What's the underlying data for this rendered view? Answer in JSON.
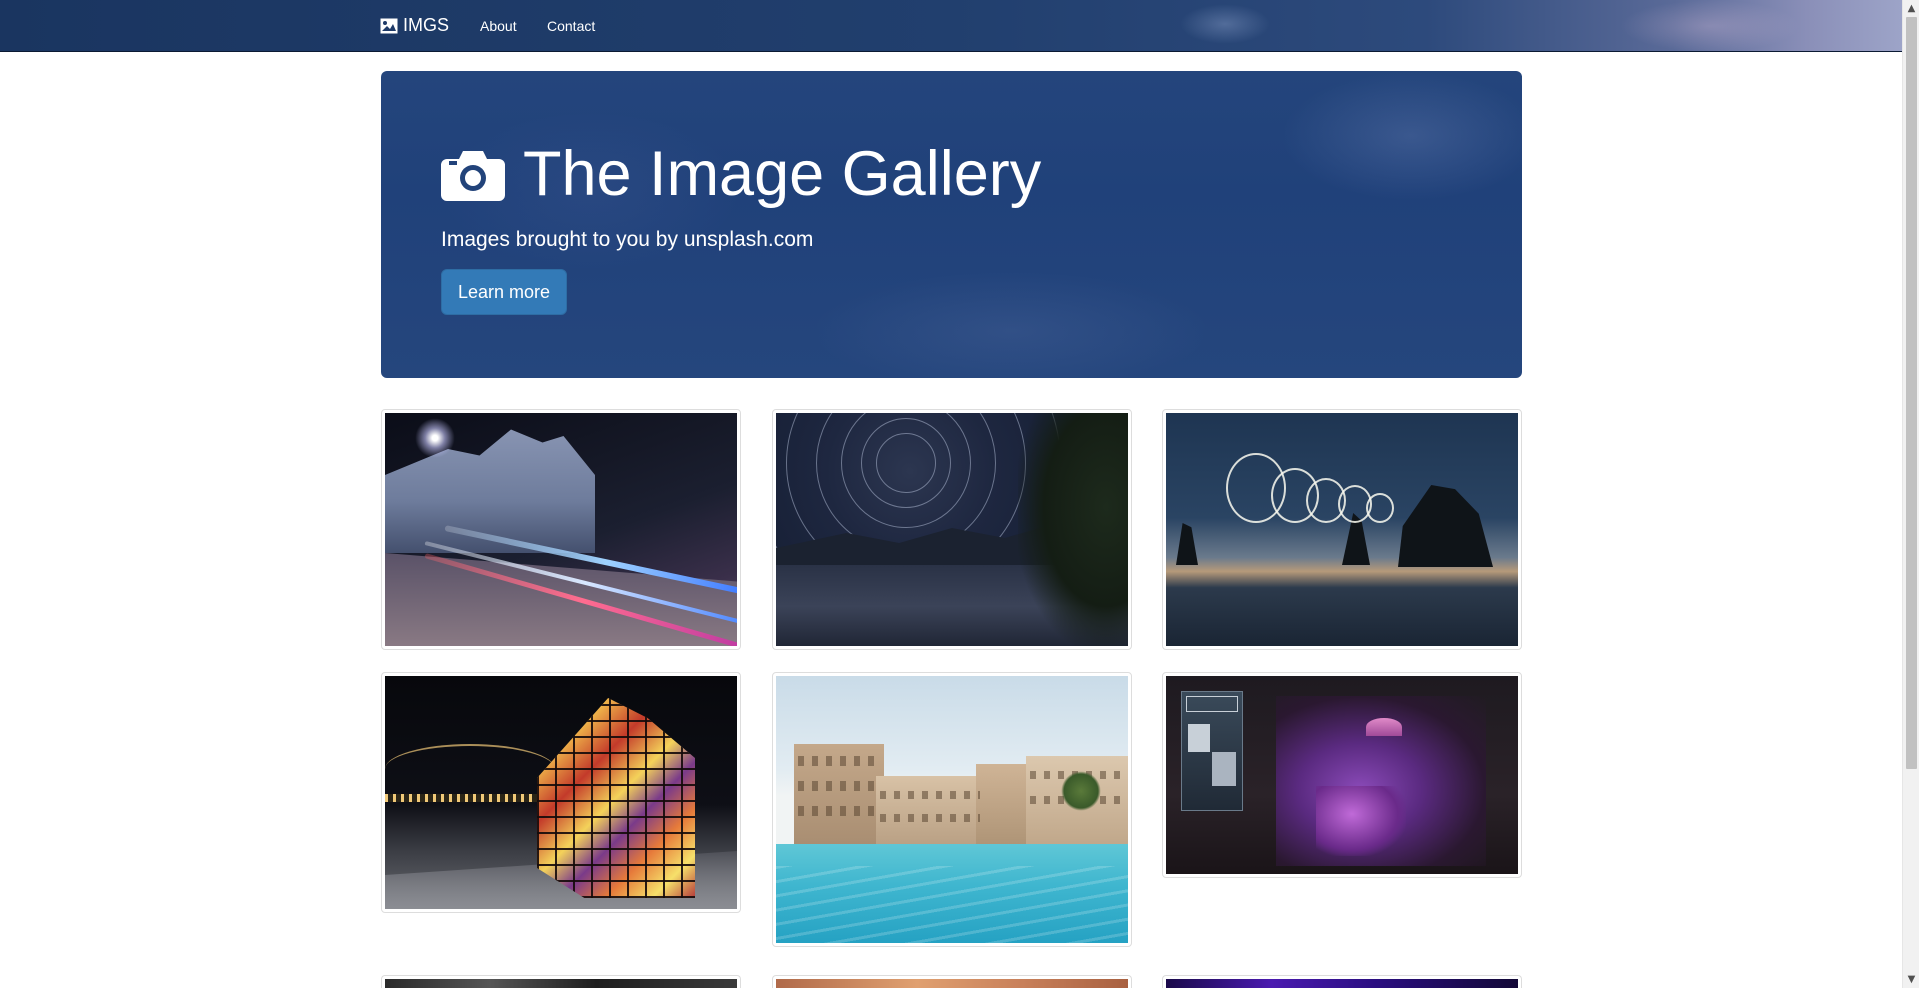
{
  "navbar": {
    "brand": "IMGS",
    "brand_icon": "picture-icon",
    "links": [
      "About",
      "Contact"
    ]
  },
  "hero": {
    "icon": "camera-icon",
    "title": "The Image Gallery",
    "subtitle": "Images brought to you by unsplash.com",
    "button_label": "Learn more"
  },
  "colors": {
    "navbar_bg": "#213f6e",
    "hero_bg": "#24457c",
    "button_bg": "#337ab7",
    "thumb_border": "#dddddd"
  },
  "gallery": {
    "images": [
      "city-light-trails-image",
      "star-trails-image",
      "light-painting-seascape-image",
      "stained-glass-house-image",
      "resort-pool-image",
      "cafe-window-image",
      "partial-image-7",
      "partial-image-8",
      "partial-image-9"
    ]
  }
}
